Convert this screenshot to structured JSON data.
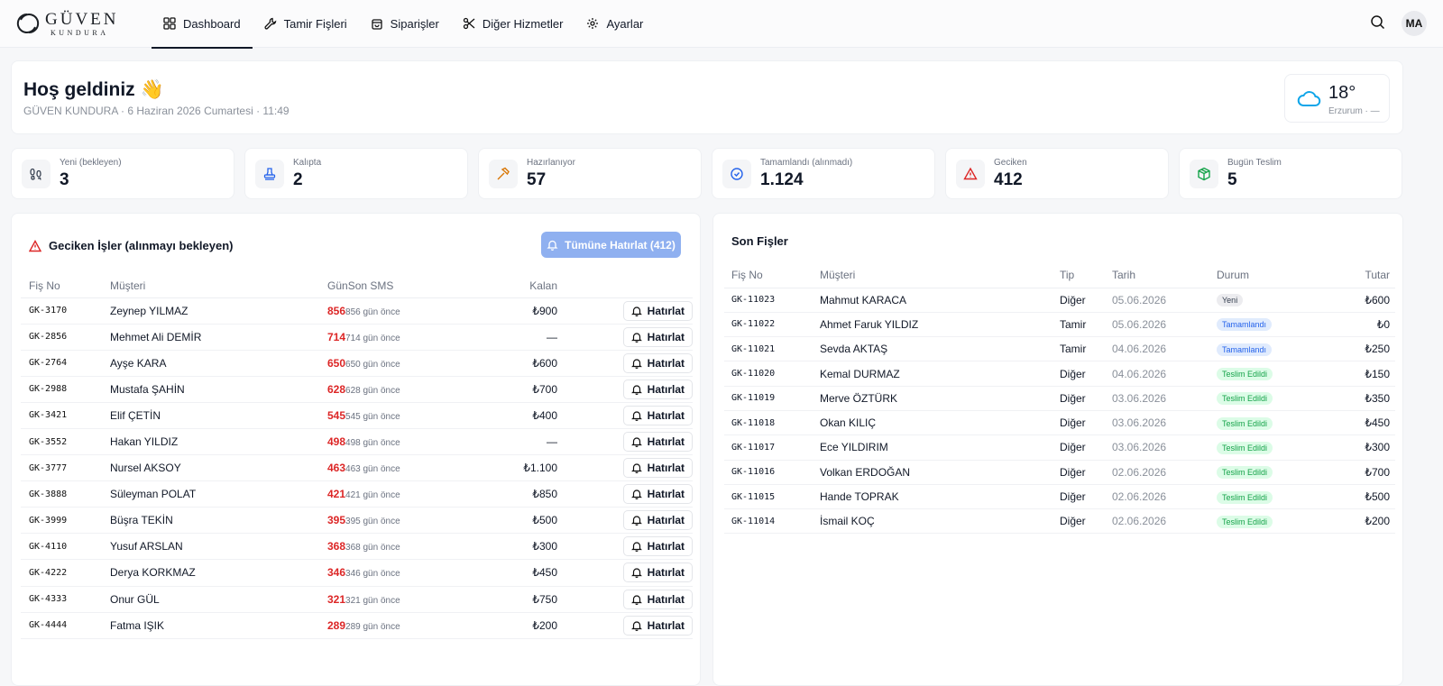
{
  "brand": {
    "name": "GÜVEN",
    "sub": "KUNDURA"
  },
  "nav": [
    {
      "label": "Dashboard",
      "icon": "grid-icon",
      "active": true
    },
    {
      "label": "Tamir Fişleri",
      "icon": "wrench-icon"
    },
    {
      "label": "Siparişler",
      "icon": "shopping-bag-icon"
    },
    {
      "label": "Diğer Hizmetler",
      "icon": "scissors-icon"
    },
    {
      "label": "Ayarlar",
      "icon": "gear-icon"
    }
  ],
  "user": {
    "initials": "MA"
  },
  "welcome": {
    "title": "Hoş geldiniz 👋",
    "subtitle": "GÜVEN KUNDURA · 6 Haziran 2026 Cumartesi · 11:49"
  },
  "weather": {
    "temp": "18°",
    "city": "Erzurum · —",
    "icon": "cloud-icon"
  },
  "stats": [
    {
      "label": "Yeni (bekleyen)",
      "value": "3",
      "icon": "footprints-icon",
      "color": "#374151"
    },
    {
      "label": "Kalıpta",
      "value": "2",
      "icon": "stamp-icon",
      "color": "#2563eb"
    },
    {
      "label": "Hazırlanıyor",
      "value": "57",
      "icon": "hammer-icon",
      "color": "#d97706"
    },
    {
      "label": "Tamamlandı (alınmadı)",
      "value": "1.124",
      "icon": "check-circle-icon",
      "color": "#2563eb"
    },
    {
      "label": "Geciken",
      "value": "412",
      "icon": "alert-triangle-icon",
      "color": "#dc2626"
    },
    {
      "label": "Bugün Teslim",
      "value": "5",
      "icon": "package-icon",
      "color": "#16a34a"
    }
  ],
  "overdue": {
    "title": "Geciken İşler (alınmayı bekleyen)",
    "remind_all": "Tümüne Hatırlat (412)",
    "columns": {
      "fis": "Fiş No",
      "musteri": "Müşteri",
      "gun": "Gün",
      "sms": "Son SMS",
      "kalan": "Kalan"
    },
    "button_label": "Hatırlat",
    "rows": [
      {
        "fis": "GK-3170",
        "musteri": "Zeynep YILMAZ",
        "gun": "856",
        "sms": "856 gün önce",
        "kalan": "₺900"
      },
      {
        "fis": "GK-2856",
        "musteri": "Mehmet Ali DEMİR",
        "gun": "714",
        "sms": "714 gün önce",
        "kalan": "—"
      },
      {
        "fis": "GK-2764",
        "musteri": "Ayşe KARA",
        "gun": "650",
        "sms": "650 gün önce",
        "kalan": "₺600"
      },
      {
        "fis": "GK-2988",
        "musteri": "Mustafa ŞAHİN",
        "gun": "628",
        "sms": "628 gün önce",
        "kalan": "₺700"
      },
      {
        "fis": "GK-3421",
        "musteri": "Elif ÇETİN",
        "gun": "545",
        "sms": "545 gün önce",
        "kalan": "₺400"
      },
      {
        "fis": "GK-3552",
        "musteri": "Hakan YILDIZ",
        "gun": "498",
        "sms": "498 gün önce",
        "kalan": "—"
      },
      {
        "fis": "GK-3777",
        "musteri": "Nursel AKSOY",
        "gun": "463",
        "sms": "463 gün önce",
        "kalan": "₺1.100"
      },
      {
        "fis": "GK-3888",
        "musteri": "Süleyman POLAT",
        "gun": "421",
        "sms": "421 gün önce",
        "kalan": "₺850"
      },
      {
        "fis": "GK-3999",
        "musteri": "Büşra TEKİN",
        "gun": "395",
        "sms": "395 gün önce",
        "kalan": "₺500"
      },
      {
        "fis": "GK-4110",
        "musteri": "Yusuf ARSLAN",
        "gun": "368",
        "sms": "368 gün önce",
        "kalan": "₺300"
      },
      {
        "fis": "GK-4222",
        "musteri": "Derya KORKMAZ",
        "gun": "346",
        "sms": "346 gün önce",
        "kalan": "₺450"
      },
      {
        "fis": "GK-4333",
        "musteri": "Onur GÜL",
        "gun": "321",
        "sms": "321 gün önce",
        "kalan": "₺750"
      },
      {
        "fis": "GK-4444",
        "musteri": "Fatma IŞIK",
        "gun": "289",
        "sms": "289 gün önce",
        "kalan": "₺200"
      }
    ]
  },
  "recent": {
    "title": "Son Fişler",
    "columns": {
      "fis": "Fiş No",
      "musteri": "Müşteri",
      "tip": "Tip",
      "tarih": "Tarih",
      "durum": "Durum",
      "tutar": "Tutar"
    },
    "status_colors": {
      "Yeni": {
        "bg": "#ececef",
        "fg": "#374151"
      },
      "Tamamlandı": {
        "bg": "#e0ebfd",
        "fg": "#2563eb"
      },
      "Teslim Edildi": {
        "bg": "#dcfce7",
        "fg": "#16a34a"
      }
    },
    "rows": [
      {
        "fis": "GK-11023",
        "musteri": "Mahmut KARACA",
        "tip": "Diğer",
        "tarih": "05.06.2026",
        "durum": "Yeni",
        "tutar": "₺600"
      },
      {
        "fis": "GK-11022",
        "musteri": "Ahmet Faruk YILDIZ",
        "tip": "Tamir",
        "tarih": "05.06.2026",
        "durum": "Tamamlandı",
        "tutar": "₺0"
      },
      {
        "fis": "GK-11021",
        "musteri": "Sevda AKTAŞ",
        "tip": "Tamir",
        "tarih": "04.06.2026",
        "durum": "Tamamlandı",
        "tutar": "₺250"
      },
      {
        "fis": "GK-11020",
        "musteri": "Kemal DURMAZ",
        "tip": "Diğer",
        "tarih": "04.06.2026",
        "durum": "Teslim Edildi",
        "tutar": "₺150"
      },
      {
        "fis": "GK-11019",
        "musteri": "Merve ÖZTÜRK",
        "tip": "Diğer",
        "tarih": "03.06.2026",
        "durum": "Teslim Edildi",
        "tutar": "₺350"
      },
      {
        "fis": "GK-11018",
        "musteri": "Okan KILIÇ",
        "tip": "Diğer",
        "tarih": "03.06.2026",
        "durum": "Teslim Edildi",
        "tutar": "₺450"
      },
      {
        "fis": "GK-11017",
        "musteri": "Ece YILDIRIM",
        "tip": "Diğer",
        "tarih": "03.06.2026",
        "durum": "Teslim Edildi",
        "tutar": "₺300"
      },
      {
        "fis": "GK-11016",
        "musteri": "Volkan ERDOĞAN",
        "tip": "Diğer",
        "tarih": "02.06.2026",
        "durum": "Teslim Edildi",
        "tutar": "₺700"
      },
      {
        "fis": "GK-11015",
        "musteri": "Hande TOPRAK",
        "tip": "Diğer",
        "tarih": "02.06.2026",
        "durum": "Teslim Edildi",
        "tutar": "₺500"
      },
      {
        "fis": "GK-11014",
        "musteri": "İsmail KOÇ",
        "tip": "Diğer",
        "tarih": "02.06.2026",
        "durum": "Teslim Edildi",
        "tutar": "₺200"
      }
    ]
  }
}
